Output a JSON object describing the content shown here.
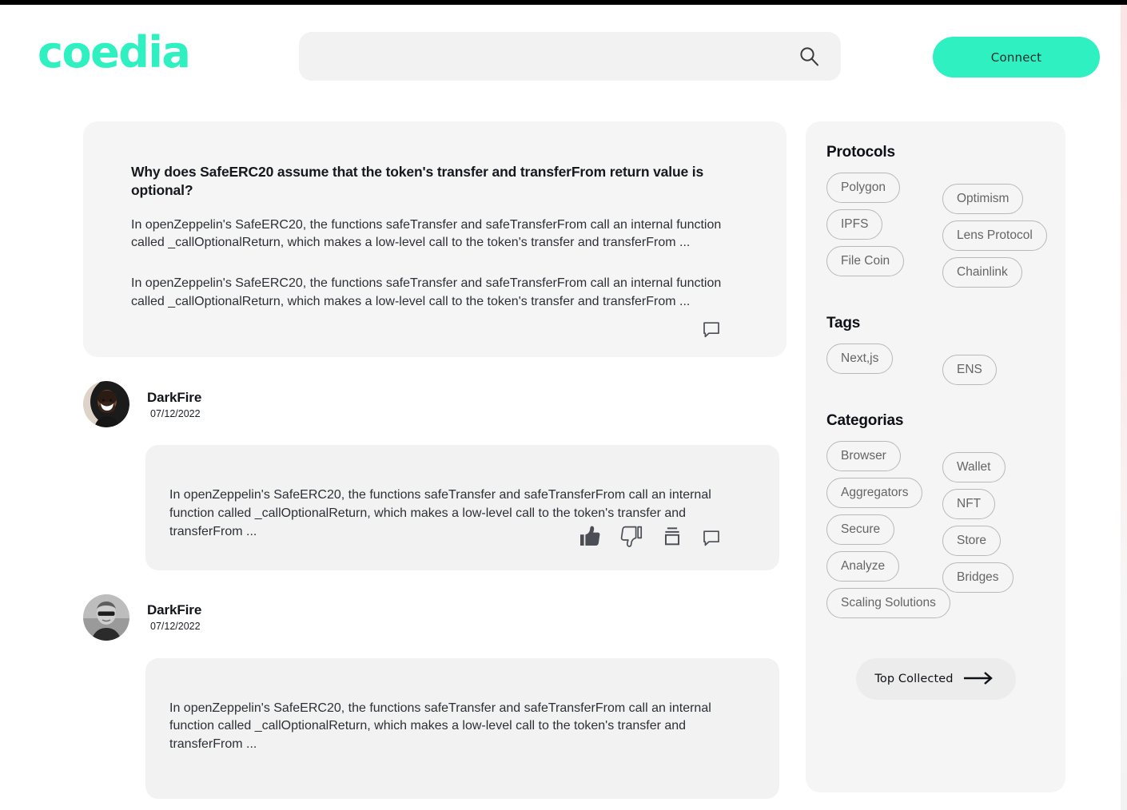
{
  "header": {
    "logo_text": "coedia",
    "search": {
      "value": "",
      "placeholder": ""
    },
    "search_icon": "search-icon",
    "connect_label": "Connect"
  },
  "question": {
    "title": "Why does SafeERC20 assume that the token's transfer and transferFrom return value is optional?",
    "paragraphs": [
      "In openZeppelin's SafeERC20, the functions safeTransfer and safeTransferFrom call an internal function called _callOptionalReturn, which makes a low-level call to the token's transfer and transferFrom ...",
      "In openZeppelin's SafeERC20, the functions safeTransfer and safeTransferFrom call an internal function called _callOptionalReturn, which makes a low-level call to the token's transfer and transferFrom ..."
    ],
    "comment_icon": "comment-icon"
  },
  "answers": [
    {
      "author": "DarkFire",
      "date": "07/12/2022",
      "avatar": "avatar-photo-color",
      "body": "In openZeppelin's SafeERC20, the functions safeTransfer and safeTransferFrom call an internal function called _callOptionalReturn, which makes a low-level call to the token's transfer and transferFrom ...",
      "actions": [
        "thumbs-up-icon",
        "thumbs-down-icon",
        "archive-icon",
        "comment-icon"
      ]
    },
    {
      "author": "DarkFire",
      "date": "07/12/2022",
      "avatar": "avatar-photo-grayscale",
      "body": "In openZeppelin's SafeERC20, the functions safeTransfer and safeTransferFrom call an internal function called _callOptionalReturn, which makes a low-level call to the token's transfer and transferFrom ...",
      "actions": []
    }
  ],
  "sidebar": {
    "protocols": {
      "heading": "Protocols",
      "rows": [
        {
          "a": "Polygon",
          "b": "Optimism"
        },
        {
          "a": "IPFS",
          "b": "Lens Protocol"
        },
        {
          "a": "File Coin",
          "b": "Chainlink"
        }
      ]
    },
    "tags": {
      "heading": "Tags",
      "rows": [
        {
          "a": "Next,js",
          "b": "ENS"
        }
      ]
    },
    "categories": {
      "heading": "Categorias",
      "rows": [
        {
          "a": "Browser",
          "b": "Wallet"
        },
        {
          "a": "Aggregators",
          "b": "NFT"
        },
        {
          "a": "Secure",
          "b": "Store"
        },
        {
          "a": "Analyze",
          "b": "Bridges"
        }
      ],
      "solo": "Scaling Solutions"
    },
    "top_collected": {
      "label": "Top Collected",
      "icon": "arrow-right-icon"
    }
  },
  "colors": {
    "brand": "#2ff0c0",
    "card_bg": "#f5f5f5",
    "answer_bg": "#f2f2f2",
    "pill_border": "#b9b9b9",
    "pill_text": "#656565"
  }
}
